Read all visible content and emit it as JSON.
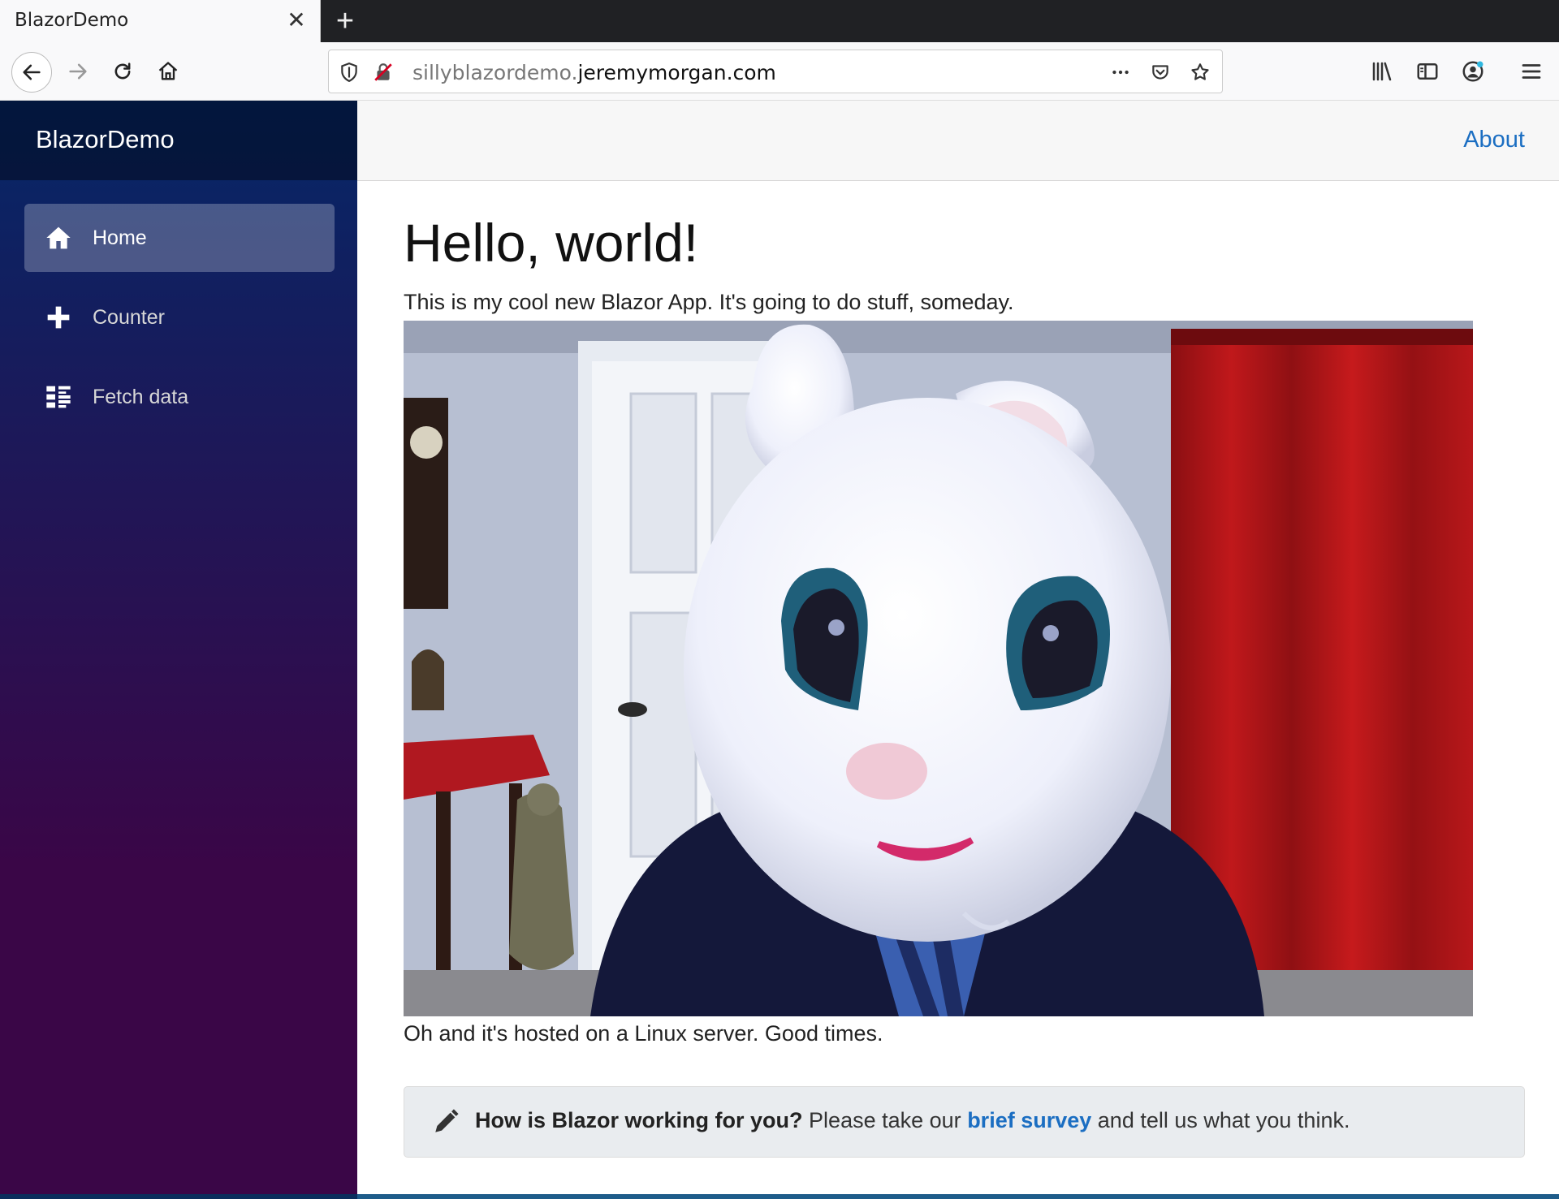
{
  "browser": {
    "tab_title": "BlazorDemo",
    "url_dim": "sillyblazordemo.",
    "url_main": "jeremymorgan.com"
  },
  "app": {
    "brand": "BlazorDemo",
    "nav": [
      {
        "label": "Home",
        "icon": "home-icon",
        "active": true
      },
      {
        "label": "Counter",
        "icon": "plus-icon",
        "active": false
      },
      {
        "label": "Fetch data",
        "icon": "list-icon",
        "active": false
      }
    ],
    "about": "About"
  },
  "page": {
    "heading": "Hello, world!",
    "intro": "This is my cool new Blazor App. It's going to do stuff, someday.",
    "outro": "Oh and it's hosted on a Linux server. Good times.",
    "survey": {
      "question": "How is Blazor working for you?",
      "pre_link": "Please take our",
      "link": "brief survey",
      "post_link": "and tell us what you think."
    }
  },
  "colors": {
    "accent_link": "#1b6ec2",
    "sidebar_top": "#052767",
    "sidebar_bottom": "#3a0647"
  }
}
